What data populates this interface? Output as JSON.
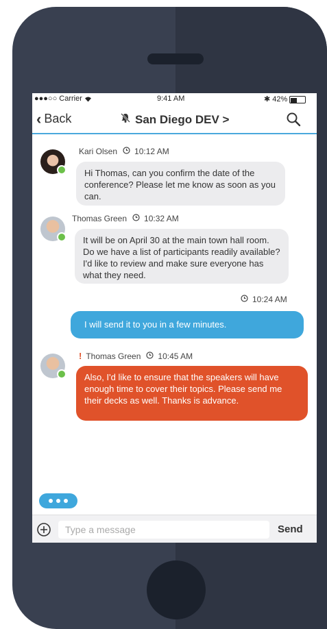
{
  "status_bar": {
    "carrier": "●●●○○ Carrier",
    "time": "9:41 AM",
    "battery": "42%"
  },
  "nav": {
    "back_label": "Back",
    "title": "San Diego DEV >"
  },
  "messages": [
    {
      "sender": "Kari Olsen",
      "time": "10:12 AM",
      "text": "Hi Thomas, can you confirm the date of the conference? Please let me know as soon as you can."
    },
    {
      "sender": "Thomas Green",
      "time": "10:32 AM",
      "text": "It will be on April 30 at the main town hall room. Do we have a list of participants readily available? I'd like to review and make sure everyone has what they need."
    },
    {
      "sender": "",
      "time": "10:24 AM",
      "text": "I will send it to you in a few minutes."
    },
    {
      "sender": "Thomas Green",
      "time": "10:45 AM",
      "urgent_mark": "!",
      "text": "Also, I'd like to ensure that the speakers will have enough time to cover their topics. Please send me their decks as well. Thanks is advance."
    }
  ],
  "composer": {
    "placeholder": "Type a message",
    "send_label": "Send"
  },
  "colors": {
    "accent_blue": "#3fa7dc",
    "urgent_orange": "#e0522a",
    "online_green": "#6cc04a"
  }
}
